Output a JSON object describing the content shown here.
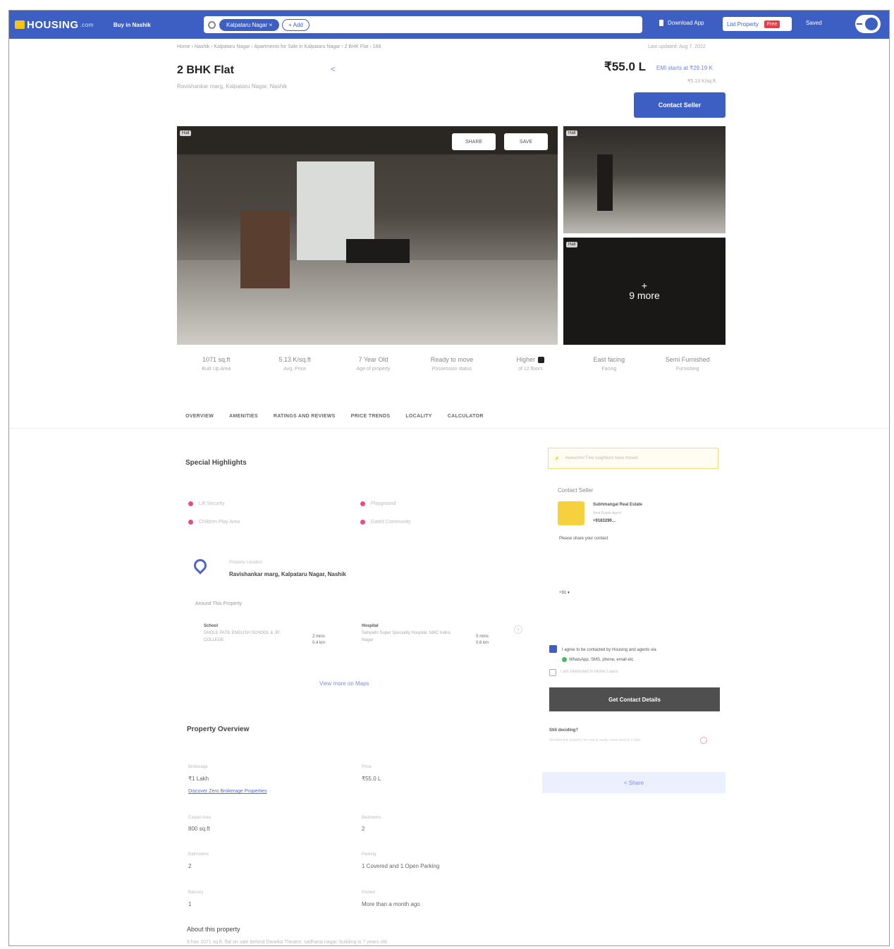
{
  "nav": {
    "logo": "HOUSING",
    "logo_suffix": ".com",
    "buy_menu": "Buy in Nashik",
    "search_chip": "Kalpataru Nagar",
    "search_chip_close": "×",
    "search_add": "+ Add",
    "download": "Download App",
    "list_property": "List Property",
    "list_free": "Free",
    "saved": "Saved"
  },
  "breadcrumb": "Home › Nashik › Kalpataru Nagar › Apartments for Sale in Kalpataru Nagar › 2 BHK Flat › 166",
  "updated": "Last updated: Aug 7, 2022",
  "listing": {
    "title": "2 BHK Flat",
    "address_sub": "Ravishankar marg, Kalpataru Nagar, Nashik",
    "price": "₹55.0 L",
    "emi": "EMI starts at ₹29.19 K",
    "per_sqft": "₹5.13 K/sq.ft.",
    "contact_button": "Contact Seller"
  },
  "gallery": {
    "tag": "Hall",
    "share": "SHARE",
    "save": "SAVE",
    "more_plus": "+",
    "more": "9 more"
  },
  "stats": [
    {
      "value": "1071 sq.ft",
      "label": "Built Up Area"
    },
    {
      "value": "5.13 K/sq.ft",
      "label": "Avg. Price"
    },
    {
      "value": "7 Year Old",
      "label": "Age of property"
    },
    {
      "value": "Ready to move",
      "label": "Possession status"
    },
    {
      "value": "Higher",
      "label": "of 12 floors"
    },
    {
      "value": "East facing",
      "label": "Facing"
    },
    {
      "value": "Semi Furnished",
      "label": "Furnishing"
    }
  ],
  "tabs": [
    "OVERVIEW",
    "AMENITIES",
    "RATINGS AND REVIEWS",
    "PRICE TRENDS",
    "LOCALITY",
    "CALCULATOR"
  ],
  "highlights": {
    "title": "Special Highlights",
    "items": [
      "Lift Security",
      "Playground",
      "Children Play Area",
      "Gated Community"
    ]
  },
  "location": {
    "label": "Property Location",
    "address": "Ravishankar marg, Kalpataru Nagar, Nashik",
    "around_title": "Around This Property",
    "pois": [
      {
        "type": "School",
        "name": "DHOLE PATIL ENGLISH SCHOOL & JR. COLLEGE",
        "time": "2 mins",
        "distance": "0.4 km"
      },
      {
        "type": "Hospital",
        "name": "Sahyadri Super Speciality Hospital, NMC Indira Nagar",
        "time": "5 mins",
        "distance": "0.6 km"
      }
    ],
    "next": "›",
    "view_maps": "View more on Maps"
  },
  "overview": {
    "title": "Property Overview",
    "rows": [
      {
        "l_label": "Brokerage",
        "l_value": "₹1 Lakh",
        "r_label": "Price",
        "r_value": "₹55.0 L"
      },
      {
        "l_label": "Carpet Area",
        "l_value": "800 sq.ft",
        "r_label": "Bedrooms",
        "r_value": "2"
      },
      {
        "l_label": "Bathrooms",
        "l_value": "2",
        "r_label": "Parking",
        "r_value": "1 Covered and 1 Open Parking"
      },
      {
        "l_label": "Balcony",
        "l_value": "1",
        "r_label": "Posted",
        "r_value": "More than a month ago"
      }
    ],
    "link": "Discover Zero Brokerage Properties",
    "about_title": "About this property",
    "about_text": "It has 1071 sq.ft. flat on sale behind Dwarka Theatre, sadhana nagar, building is 7 years old."
  },
  "sidebar": {
    "highlight": "Awesome! Few neighbors have moved",
    "contact_title": "Contact Seller",
    "seller_name": "Subhmangal Real Estate",
    "seller_role": "Real Estate Agent",
    "seller_phone": "+9183290...",
    "share_contact": "Please share your contact",
    "country_code": "+91",
    "agree_text": "I agree to be contacted by Housing and agents via",
    "agree_channels": "WhatsApp, SMS, phone, email etc",
    "home_loan": "I am interested in Home Loans",
    "get_button": "Get Contact Details",
    "still_deciding": "Still deciding?",
    "still_sub": "Shortlist this property for now & easily come back to it later",
    "share": "Share"
  }
}
